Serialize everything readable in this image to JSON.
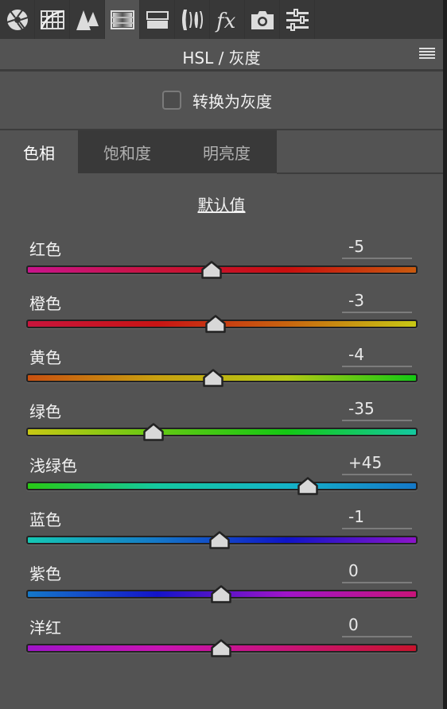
{
  "toolbar": {
    "icons": [
      {
        "name": "basic-aperture-icon",
        "active": false
      },
      {
        "name": "tone-curve-icon",
        "active": false
      },
      {
        "name": "detail-mountains-icon",
        "active": false
      },
      {
        "name": "hsl-grayscale-icon",
        "active": true
      },
      {
        "name": "split-toning-icon",
        "active": false
      },
      {
        "name": "lens-corrections-icon",
        "active": false
      },
      {
        "name": "effects-fx-icon",
        "active": false
      },
      {
        "name": "camera-calibration-icon",
        "active": false
      },
      {
        "name": "presets-sliders-icon",
        "active": false
      }
    ]
  },
  "header": {
    "title": "HSL / 灰度"
  },
  "grayscale": {
    "label": "转换为灰度",
    "checked": false
  },
  "tabs": [
    {
      "label": "色相",
      "active": true
    },
    {
      "label": "饱和度",
      "active": false
    },
    {
      "label": "明亮度",
      "active": false
    }
  ],
  "defaults_label": "默认值",
  "slider_range": [
    -100,
    100
  ],
  "sliders": [
    {
      "label": "红色",
      "value": "-5",
      "numeric": -5,
      "gradient": [
        "#c8148c",
        "#c8143c",
        "#c80f0f",
        "#c85a0f"
      ]
    },
    {
      "label": "橙色",
      "value": "-3",
      "numeric": -3,
      "gradient": [
        "#c8143c",
        "#c81414",
        "#c8640f",
        "#c8c814"
      ]
    },
    {
      "label": "黄色",
      "value": "-4",
      "numeric": -4,
      "gradient": [
        "#c8500f",
        "#c8a00f",
        "#b4c814",
        "#14c814"
      ]
    },
    {
      "label": "绿色",
      "value": "-35",
      "numeric": -35,
      "gradient": [
        "#c8c814",
        "#64c814",
        "#14c814",
        "#14c8a0"
      ]
    },
    {
      "label": "浅绿色",
      "value": "+45",
      "numeric": 45,
      "gradient": [
        "#28c814",
        "#14c8a0",
        "#14b4c8",
        "#1478c8"
      ]
    },
    {
      "label": "蓝色",
      "value": "-1",
      "numeric": -1,
      "gradient": [
        "#14c8b4",
        "#1478c8",
        "#0f14c8",
        "#8c14c8"
      ]
    },
    {
      "label": "紫色",
      "value": "0",
      "numeric": 0,
      "gradient": [
        "#1478c8",
        "#1414c8",
        "#a014c8",
        "#c8147a"
      ]
    },
    {
      "label": "洋红",
      "value": "0",
      "numeric": 0,
      "gradient": [
        "#a014c8",
        "#c814b4",
        "#c81478",
        "#c8142d"
      ]
    }
  ]
}
